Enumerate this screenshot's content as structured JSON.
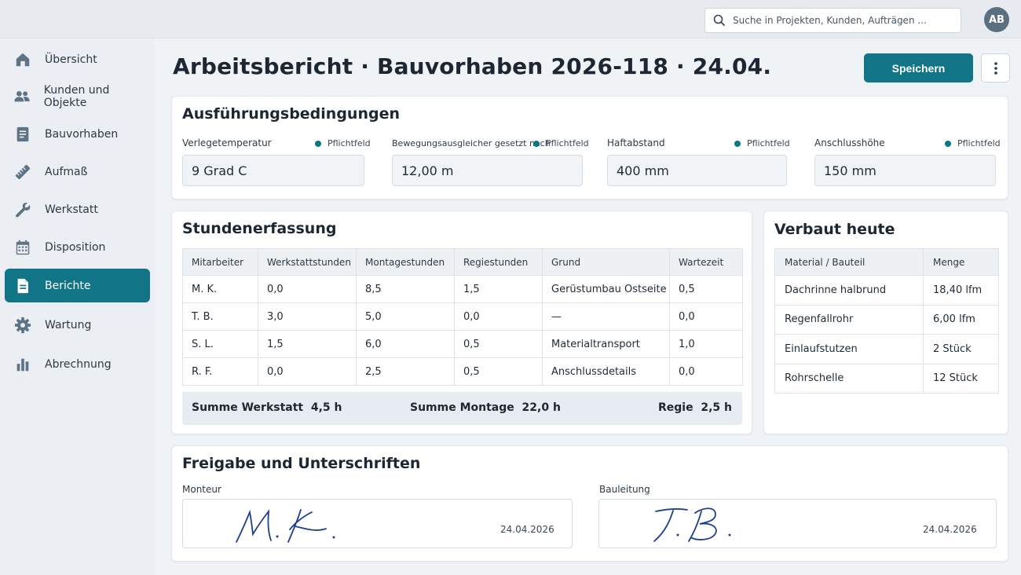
{
  "topbar": {
    "search_placeholder": "Suche in Projekten, Kunden, Aufträgen ...",
    "avatar_initials": "AB"
  },
  "sidebar": {
    "items": [
      {
        "label": "Übersicht",
        "icon": "home-icon"
      },
      {
        "label": "Kunden und Objekte",
        "icon": "users-icon"
      },
      {
        "label": "Bauvorhaben",
        "icon": "document-icon"
      },
      {
        "label": "Aufmaß",
        "icon": "ruler-icon"
      },
      {
        "label": "Werkstatt",
        "icon": "wrench-icon"
      },
      {
        "label": "Disposition",
        "icon": "calendar-icon"
      },
      {
        "label": "Berichte",
        "icon": "report-icon",
        "active": true
      },
      {
        "label": "Wartung",
        "icon": "gear-icon"
      },
      {
        "label": "Abrechnung",
        "icon": "bar-chart-icon"
      }
    ]
  },
  "header": {
    "title": "Arbeitsbericht · Bauvorhaben 2026-118 · 24.04.",
    "save_label": "Speichern"
  },
  "conditions": {
    "title": "Ausführungsbedingungen",
    "fields": [
      {
        "label": "Verlegetemperatur",
        "required": "Pflichtfeld",
        "value": "9 Grad C"
      },
      {
        "label": "Bewegungsausgleicher gesetzt nach",
        "required": "Pflichtfeld",
        "value": "12,00 m"
      },
      {
        "label": "Haftabstand",
        "required": "Pflichtfeld",
        "value": "400 mm"
      },
      {
        "label": "Anschlusshöhe",
        "required": "Pflichtfeld",
        "value": "150 mm"
      }
    ]
  },
  "hours": {
    "title": "Stundenerfassung",
    "columns": [
      "Mitarbeiter",
      "Werkstattstunden",
      "Montagestunden",
      "Regiestunden",
      "Grund",
      "Wartezeit"
    ],
    "rows": [
      [
        "M. K.",
        "0,0",
        "8,5",
        "1,5",
        "Gerüstumbau Ostseite",
        "0,5"
      ],
      [
        "T. B.",
        "3,0",
        "5,0",
        "0,0",
        "—",
        "0,0"
      ],
      [
        "S. L.",
        "1,5",
        "6,0",
        "0,5",
        "Materialtransport",
        "1,0"
      ],
      [
        "R. F.",
        "0,0",
        "2,5",
        "0,5",
        "Anschlussdetails",
        "0,0"
      ]
    ],
    "sum_workshop_label": "Summe Werkstatt",
    "sum_workshop_value": "4,5 h",
    "sum_montage_label": "Summe Montage",
    "sum_montage_value": "22,0 h",
    "regie_label": "Regie",
    "regie_value": "2,5 h"
  },
  "materials": {
    "title": "Verbaut heute",
    "columns": [
      "Material / Bauteil",
      "Menge"
    ],
    "rows": [
      [
        "Dachrinne halbrund",
        "18,40 lfm"
      ],
      [
        "Regenfallrohr",
        "6,00 lfm"
      ],
      [
        "Einlaufstutzen",
        "2 Stück"
      ],
      [
        "Rohrschelle",
        "12 Stück"
      ]
    ]
  },
  "signatures": {
    "title": "Freigabe und Unterschriften",
    "monteur_label": "Monteur",
    "monteur_signature": "M. K.",
    "monteur_date": "24.04.2026",
    "bauleitung_label": "Bauleitung",
    "bauleitung_signature": "T. B.",
    "bauleitung_date": "24.04.2026"
  },
  "colors": {
    "accent": "#117487",
    "signature_ink": "#1e3f8f"
  }
}
